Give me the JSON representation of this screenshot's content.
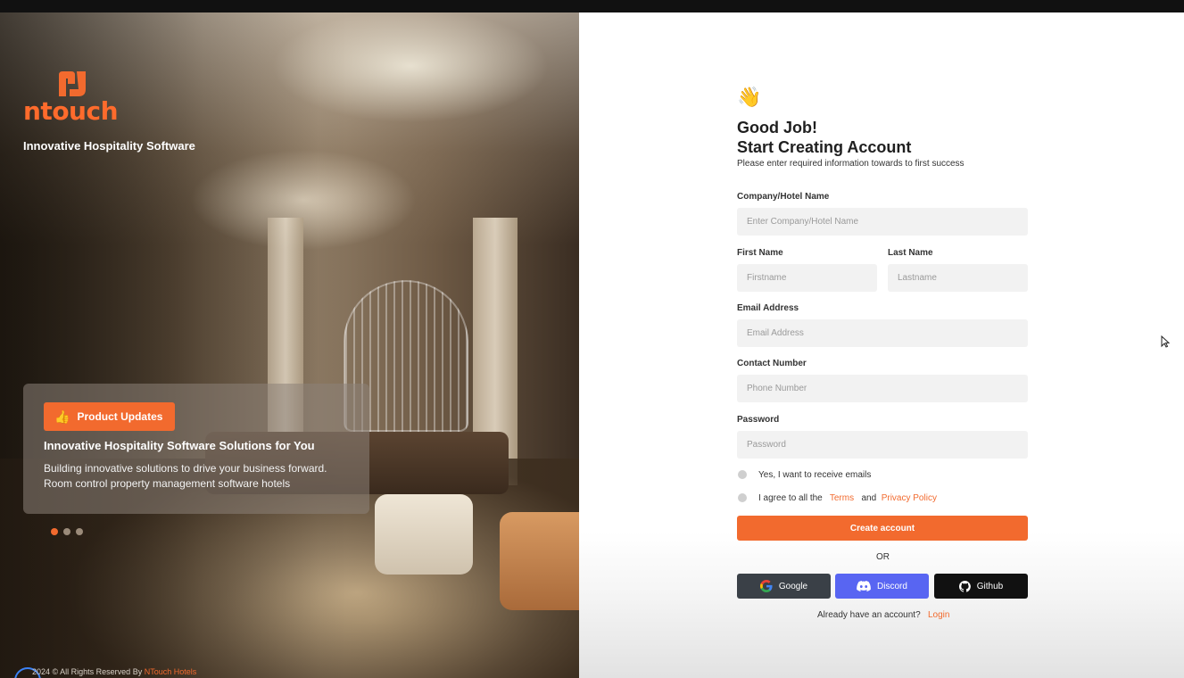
{
  "brand": {
    "logo_text": "ntouch",
    "tagline": "Innovative Hospitality Software",
    "accent_color": "#f26a2e"
  },
  "hero_card": {
    "badge_label": "Product Updates",
    "title": "Innovative Hospitality Software Solutions for You",
    "line1": "Building innovative solutions to drive your business forward.",
    "line2": "Room control  property management software hotels"
  },
  "carousel": {
    "active_index": 0,
    "count": 3
  },
  "footer": {
    "prefix": "2024 ©  All Rights Reserved By ",
    "brand": "NTouch Hotels"
  },
  "form": {
    "wave_icon": "👋",
    "heading1": "Good Job!",
    "heading2": "Start Creating Account",
    "subtitle": "Please enter required information towards to first success",
    "company": {
      "label": "Company/Hotel Name",
      "placeholder": "Enter Company/Hotel Name"
    },
    "first_name": {
      "label": "First Name",
      "placeholder": "Firstname"
    },
    "last_name": {
      "label": "Last Name",
      "placeholder": "Lastname"
    },
    "email": {
      "label": "Email Address",
      "placeholder": "Email Address"
    },
    "contact": {
      "label": "Contact Number",
      "placeholder": "Phone Number"
    },
    "password": {
      "label": "Password",
      "placeholder": "Password"
    },
    "emails_opt": "Yes, I want to receive emails",
    "agree_prefix": "I agree to all the",
    "terms": "Terms",
    "and": "and",
    "privacy": "Privacy Policy",
    "create_button": "Create account",
    "or": "OR",
    "google": "Google",
    "discord": "Discord",
    "github": "Github",
    "already": "Already have an account?",
    "login": "Login"
  }
}
